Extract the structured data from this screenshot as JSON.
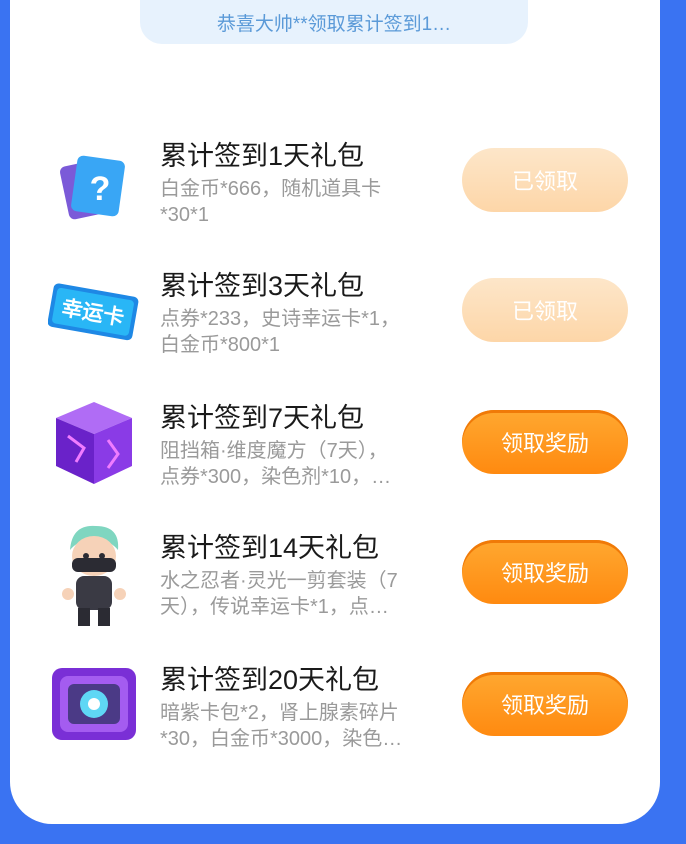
{
  "marquee": "恭喜大帅**领取累计签到1…",
  "rows": [
    {
      "title": "累计签到1天礼包",
      "desc1": "白金币*666，随机道具卡",
      "desc2": "*30*1",
      "button": "已领取",
      "state": "claimed",
      "icon": "mystery-card-icon"
    },
    {
      "title": "累计签到3天礼包",
      "desc1": "点券*233，史诗幸运卡*1，",
      "desc2": "白金币*800*1",
      "button": "已领取",
      "state": "claimed",
      "icon": "lucky-card-icon",
      "icon_text": "幸运卡"
    },
    {
      "title": "累计签到7天礼包",
      "desc1": "阻挡箱·维度魔方（7天），",
      "desc2": "点券*300，染色剂*10，…",
      "button": "领取奖励",
      "state": "claimable",
      "icon": "purple-cube-icon"
    },
    {
      "title": "累计签到14天礼包",
      "desc1": "水之忍者·灵光一剪套装（7",
      "desc2": "天），传说幸运卡*1，点…",
      "button": "领取奖励",
      "state": "claimable",
      "icon": "ninja-character-icon"
    },
    {
      "title": "累计签到20天礼包",
      "desc1": "暗紫卡包*2，肾上腺素碎片",
      "desc2": "*30，白金币*3000，染色…",
      "button": "领取奖励",
      "state": "claimable",
      "icon": "card-pack-icon"
    }
  ],
  "colors": {
    "background": "#3a73f2",
    "claim_button": "#ff9a20",
    "claimed_button": "#fddcb4",
    "marquee_bg": "#e7f2fd"
  }
}
